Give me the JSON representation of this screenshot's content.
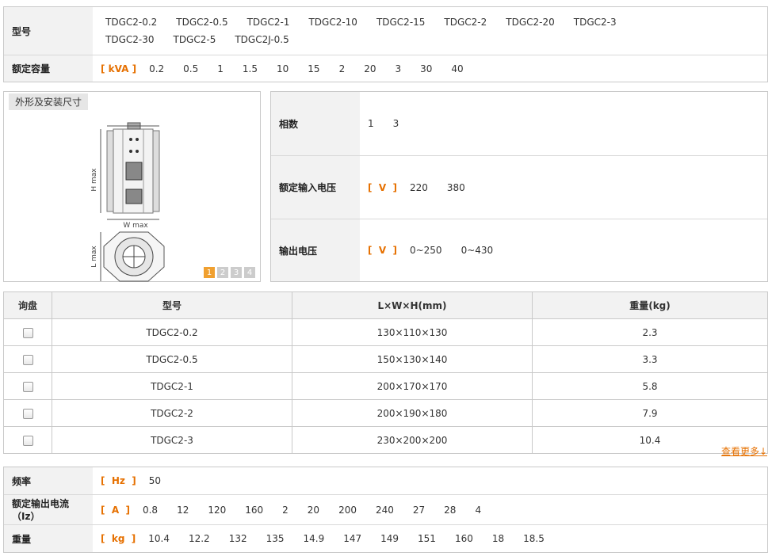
{
  "top": {
    "model_label": "型号",
    "models": [
      "TDGC2-0.2",
      "TDGC2-0.5",
      "TDGC2-1",
      "TDGC2-10",
      "TDGC2-15",
      "TDGC2-2",
      "TDGC2-20",
      "TDGC2-3",
      "TDGC2-30",
      "TDGC2-5",
      "TDGC2J-0.5"
    ],
    "capacity_label": "额定容量",
    "capacity_unit": "[ kVA ]",
    "capacity_values": [
      "0.2",
      "0.5",
      "1",
      "1.5",
      "10",
      "15",
      "2",
      "20",
      "3",
      "30",
      "40"
    ]
  },
  "image_panel": {
    "tab_label": "外形及安装尺寸",
    "h_label": "H max",
    "w_label": "W max",
    "l_label": "L max",
    "pages": [
      "1",
      "2",
      "3",
      "4"
    ]
  },
  "specs": {
    "phase_label": "相数",
    "phase_values": [
      "1",
      "3"
    ],
    "input_label": "额定输入电压",
    "input_unit": "[  V  ]",
    "input_values": [
      "220",
      "380"
    ],
    "output_label": "输出电压",
    "output_unit": "[  V  ]",
    "output_values": [
      "0~250",
      "0~430"
    ]
  },
  "table": {
    "headers": [
      "询盘",
      "型号",
      "L×W×H(mm)",
      "重量(kg)"
    ],
    "rows": [
      {
        "model": "TDGC2-0.2",
        "dims": "130×110×130",
        "weight": "2.3"
      },
      {
        "model": "TDGC2-0.5",
        "dims": "150×130×140",
        "weight": "3.3"
      },
      {
        "model": "TDGC2-1",
        "dims": "200×170×170",
        "weight": "5.8"
      },
      {
        "model": "TDGC2-2",
        "dims": "200×190×180",
        "weight": "7.9"
      },
      {
        "model": "TDGC2-3",
        "dims": "230×200×200",
        "weight": "10.4"
      }
    ],
    "more_link": "查看更多↓"
  },
  "bottom": {
    "freq_label": "频率",
    "freq_unit": "[  Hz  ]",
    "freq_values": [
      "50"
    ],
    "current_label_1": "额定输出电流",
    "current_label_2": "（Iz）",
    "current_unit": "[  A  ]",
    "current_values": [
      "0.8",
      "12",
      "120",
      "160",
      "2",
      "20",
      "200",
      "240",
      "27",
      "28",
      "4"
    ],
    "weight_label": "重量",
    "weight_unit": "[  kg  ]",
    "weight_values": [
      "10.4",
      "12.2",
      "132",
      "135",
      "14.9",
      "147",
      "149",
      "151",
      "160",
      "18",
      "18.5"
    ]
  }
}
